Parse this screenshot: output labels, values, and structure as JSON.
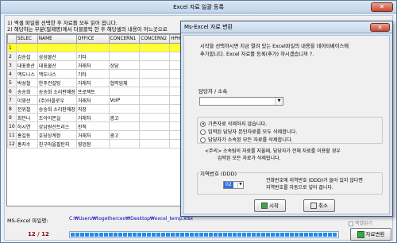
{
  "window": {
    "title": "Excel 자료 일괄 등록",
    "close_glyph": "✕"
  },
  "instructions": {
    "line1": "1) 엑셀 파일을 선택한 후 자료를 모두 읽어 옵니다.",
    "line2": "2) 해당하는 부분(필제명)에서 더블클릭 한 후 해당셀의 내용이 어느곳으로"
  },
  "grid": {
    "columns": [
      "SELEC",
      "NAME",
      "OFFICE",
      "CONCERN1",
      "CONCERN2",
      "HPHONE"
    ],
    "rows": [
      [
        "1",
        "",
        "",
        "",
        "",
        ""
      ],
      [
        "2",
        "김송섭",
        "삼성물산",
        "기타",
        "",
        ""
      ],
      [
        "3",
        "대표중산",
        "대표물산",
        "거래처",
        "상담",
        ""
      ],
      [
        "4",
        "맥도나스",
        "맥도나스",
        "기타",
        "",
        ""
      ],
      [
        "5",
        "박성철",
        "한주컨설팅",
        "거래처",
        "협력업체",
        ""
      ],
      [
        "6",
        "송송희",
        "송송희 소리판매장",
        "프로젝트",
        "",
        ""
      ],
      [
        "7",
        "이영선",
        "(주)어플로우",
        "거래처",
        "VoIP",
        ""
      ],
      [
        "8",
        "전위철",
        "송송희 소리판매장",
        "직장",
        "",
        ""
      ],
      [
        "9",
        "최민나",
        "조아이몬실",
        "거래처",
        "광고",
        ""
      ],
      [
        "10",
        "하시연",
        "강남원선트리스",
        "친척",
        "",
        ""
      ],
      [
        "11",
        "홍길동",
        "호당상계정",
        "거래처",
        "광고",
        ""
      ],
      [
        "12",
        "홍지수",
        "친구마을필탄지",
        "영업점",
        "",
        ""
      ]
    ]
  },
  "file": {
    "label": "MS-Excel 파일명:",
    "path": "C:₩Users₩togetherceo₩Desktop₩excel_temp.xlsx"
  },
  "progress": {
    "text": "12 / 12",
    "value": 1.0
  },
  "small_checkbox_label": "엑셀읽기",
  "register_button": "자료변환",
  "dialog": {
    "title": "Ms-Excel 자료 변환",
    "close_glyph": "✕",
    "message1": "시작을 선택하시면 지금 열려 있는 Excel파일의 내용을 데이터베이스에",
    "message2": "추가합니다.    Excel 자료를 등록(추가) 하시겠습니까 ?.",
    "owner_label": "담당자 / 소속",
    "owner_value": "",
    "options": [
      {
        "label": "기존자료 삭제하지 않습니다.",
        "selected": true
      },
      {
        "label": "입력된 담당자 본인자료를 모두 삭제합니다.",
        "selected": false
      },
      {
        "label": "담당자가 소속된 모든 자료를 삭제합니다.",
        "selected": false
      }
    ],
    "note1": "<주의> 소속팀의 자료를 지울때,  담당자가 전체 자료를 이용할 경우",
    "note2": "입력된 모든 자료가 삭제됩니다.",
    "area_label": "지역번호 (DDD)",
    "area_value": "02",
    "area_desc1": "전화번호에 지역번호 (DDD)가 들어 있지 않다면",
    "area_desc2": "지역번호를 자동으로 넣어 줍니다.",
    "start_button": "시작",
    "cancel_button": "취소"
  }
}
